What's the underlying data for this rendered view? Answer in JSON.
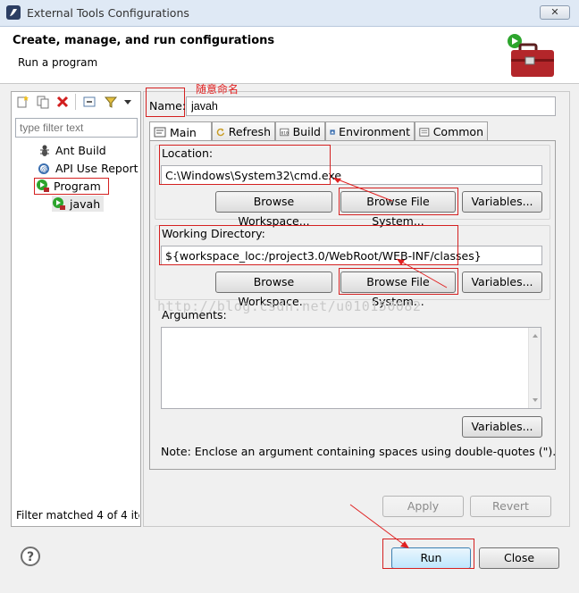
{
  "window": {
    "title": "External Tools Configurations",
    "close_glyph": "✕"
  },
  "header": {
    "title": "Create, manage, and run configurations",
    "subtitle": "Run a program"
  },
  "left": {
    "filter_placeholder": "type filter text",
    "tree": [
      {
        "label": "Ant Build",
        "icon": "ant-icon"
      },
      {
        "label": "API Use Report",
        "icon": "api-report-icon"
      },
      {
        "label": "Program",
        "icon": "program-icon"
      },
      {
        "label": "javah",
        "icon": "program-icon"
      }
    ],
    "status": "Filter matched 4 of 4 ite"
  },
  "name": {
    "label": "Name:",
    "value": "javah",
    "annotation": "随意命名"
  },
  "tabs": [
    {
      "label": "Main",
      "icon": "main-tab-icon"
    },
    {
      "label": "Refresh",
      "icon": "refresh-icon"
    },
    {
      "label": "Build",
      "icon": "build-icon"
    },
    {
      "label": "Environment",
      "icon": "environment-icon"
    },
    {
      "label": "Common",
      "icon": "common-icon"
    }
  ],
  "location": {
    "label": "Location:",
    "value": "C:\\Windows\\System32\\cmd.exe",
    "browse_workspace": "Browse Workspace...",
    "browse_fs": "Browse File System...",
    "variables": "Variables..."
  },
  "workdir": {
    "label": "Working Directory:",
    "value": "${workspace_loc:/project3.0/WebRoot/WEB-INF/classes}",
    "browse_workspace": "Browse Workspace...",
    "browse_fs": "Browse File System...",
    "variables": "Variables..."
  },
  "arguments": {
    "label": "Arguments:",
    "variables": "Variables..."
  },
  "note": "Note: Enclose an argument containing spaces using double-quotes (\").",
  "watermark": "http://blog.csdn.net/u010150082",
  "buttons": {
    "apply": "Apply",
    "revert": "Revert",
    "run": "Run",
    "close": "Close",
    "help": "?"
  },
  "colors": {
    "annotation": "#e02020",
    "accent": "#3c7fb1"
  }
}
